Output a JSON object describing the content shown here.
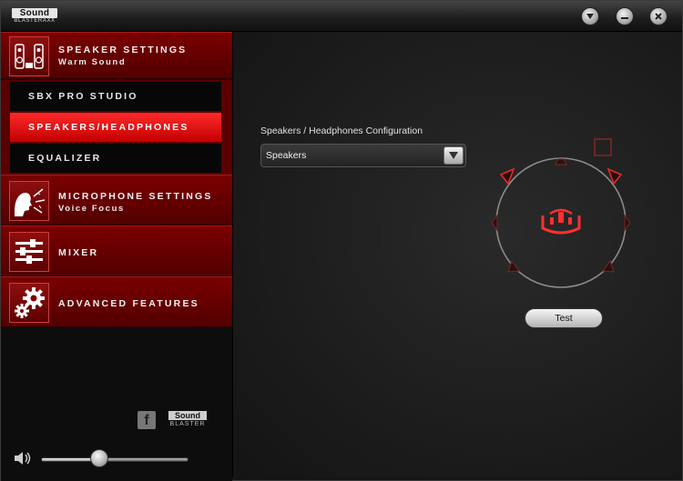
{
  "app": {
    "logo_top": "Sound",
    "logo_bottom": "BLASTERAXX"
  },
  "window_controls": [
    "menu",
    "minimize",
    "close"
  ],
  "sidebar": {
    "speaker": {
      "title": "SPEAKER SETTINGS",
      "subtitle": "Warm Sound",
      "icon": "speakers-icon"
    },
    "submenu": [
      {
        "label": "SBX PRO STUDIO",
        "active": false
      },
      {
        "label": "SPEAKERS/HEADPHONES",
        "active": true
      },
      {
        "label": "EQUALIZER",
        "active": false
      }
    ],
    "microphone": {
      "title": "MICROPHONE SETTINGS",
      "subtitle": "Voice Focus",
      "icon": "microphone-icon"
    },
    "mixer": {
      "title": "MIXER",
      "icon": "mixer-sliders-icon"
    },
    "advanced": {
      "title": "ADVANCED FEATURES",
      "icon": "gears-icon"
    },
    "footer": {
      "facebook_glyph": "f",
      "brand_top": "Sound",
      "brand_bottom": "BLASTER"
    },
    "volume": {
      "level": 0.38
    }
  },
  "main": {
    "config_label": "Speakers / Headphones Configuration",
    "config_value": "Speakers",
    "test_label": "Test"
  },
  "colors": {
    "accent": "#ff2a2a",
    "section_red": "#6a0000",
    "speaker_outline": "#e02a2a"
  }
}
